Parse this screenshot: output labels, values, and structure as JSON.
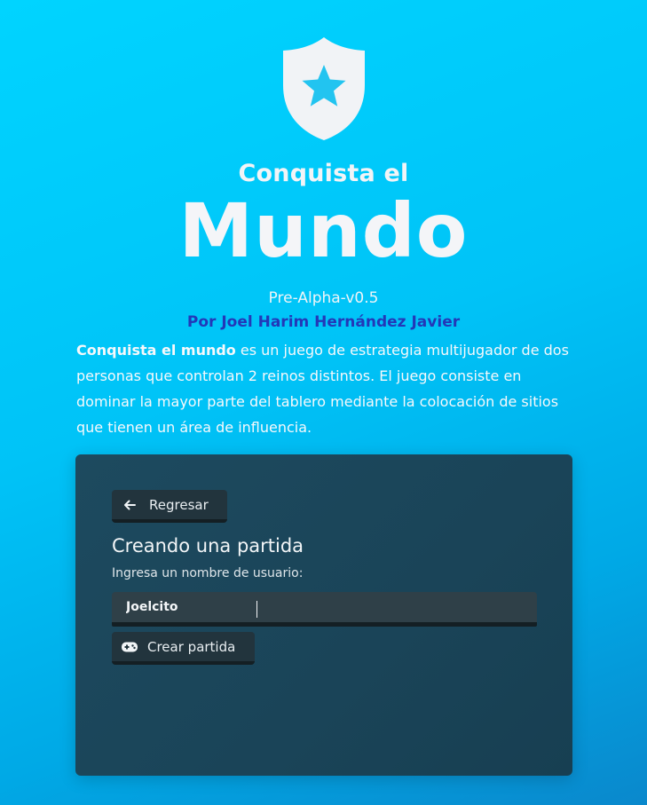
{
  "header": {
    "title_small": "Conquista el",
    "title_big": "Mundo",
    "version": "Pre-Alpha-v0.5",
    "author": "Por Joel Harim Hernández Javier",
    "logo_icon": "shield-star-icon"
  },
  "description": {
    "bold": "Conquista el mundo",
    "rest": " es un juego de estrategia multijugador de dos personas que controlan 2 reinos distintos. El juego consiste en dominar la mayor parte del tablero mediante la colocación de sitios que tienen un área de influencia."
  },
  "panel": {
    "back_label": "Regresar",
    "back_icon": "arrow-left-icon",
    "title": "Creando una partida",
    "input_label": "Ingresa un nombre de usuario:",
    "username_value": "Joelcito",
    "username_placeholder": "",
    "create_label": "Crear partida",
    "create_icon": "gamepad-icon"
  },
  "colors": {
    "background_start": "#00d4ff",
    "background_end": "#0a88cc",
    "author": "#2338b8",
    "panel": "#1a4458",
    "button": "#22343d",
    "logo_star": "#22c4f0"
  }
}
